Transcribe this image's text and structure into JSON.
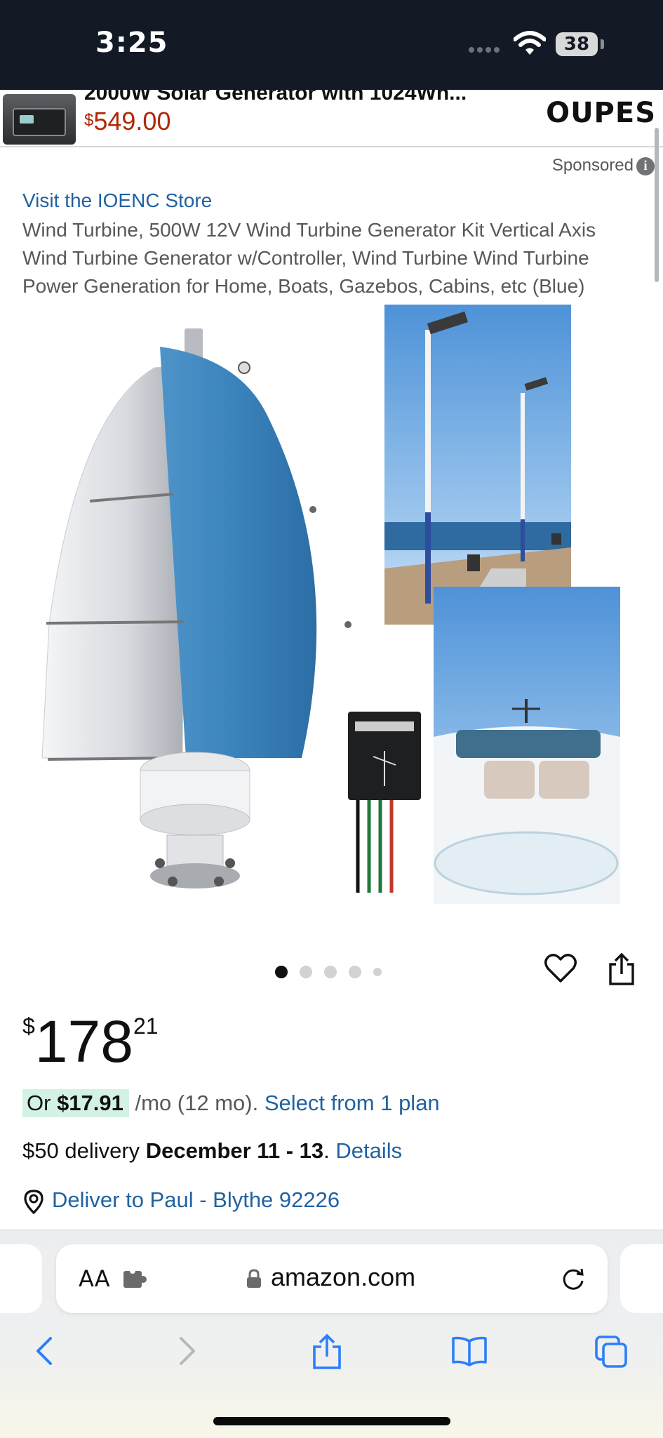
{
  "status_bar": {
    "time": "3:25",
    "battery": "38"
  },
  "top_ad": {
    "title": "2000W Solar Generator with 1024Wh...",
    "price_currency": "$",
    "price_value": "549.00",
    "brand": "OUPES"
  },
  "product": {
    "sponsored_label": "Sponsored",
    "store_link": "Visit the IOENC Store",
    "title": "Wind Turbine, 500W 12V Wind Turbine Generator Kit Vertical Axis Wind Turbine Generator w/Controller, Wind Turbine Wind Turbine Power Generation for Home, Boats, Gazebos, Cabins, etc (Blue)",
    "carousel": {
      "count": 5,
      "active_index": 0
    },
    "price": {
      "symbol": "$",
      "whole": "178",
      "fraction": "21"
    },
    "monthly": {
      "prefix": "Or ",
      "amount": "$17.91",
      "suffix": " /mo (12 mo). ",
      "link": "Select from 1 plan"
    },
    "delivery": {
      "prefix": "$50 delivery ",
      "dates": "December 11 - 13",
      "separator": ". ",
      "link": "Details"
    },
    "deliver_to": "Deliver to Paul - Blythe 92226"
  },
  "browser": {
    "text_size_label": "AA",
    "url": "amazon.com"
  },
  "colors": {
    "link": "#2162a1",
    "deal_price": "#b12704",
    "status_bar": "#141a25",
    "highlight": "#d3f2e4"
  },
  "icons": [
    "wifi-icon",
    "info-icon",
    "heart-icon",
    "share-icon",
    "pin-icon",
    "lock-icon",
    "extension-icon",
    "reload-icon",
    "back-icon",
    "forward-icon",
    "bookmarks-icon",
    "tabs-icon"
  ]
}
